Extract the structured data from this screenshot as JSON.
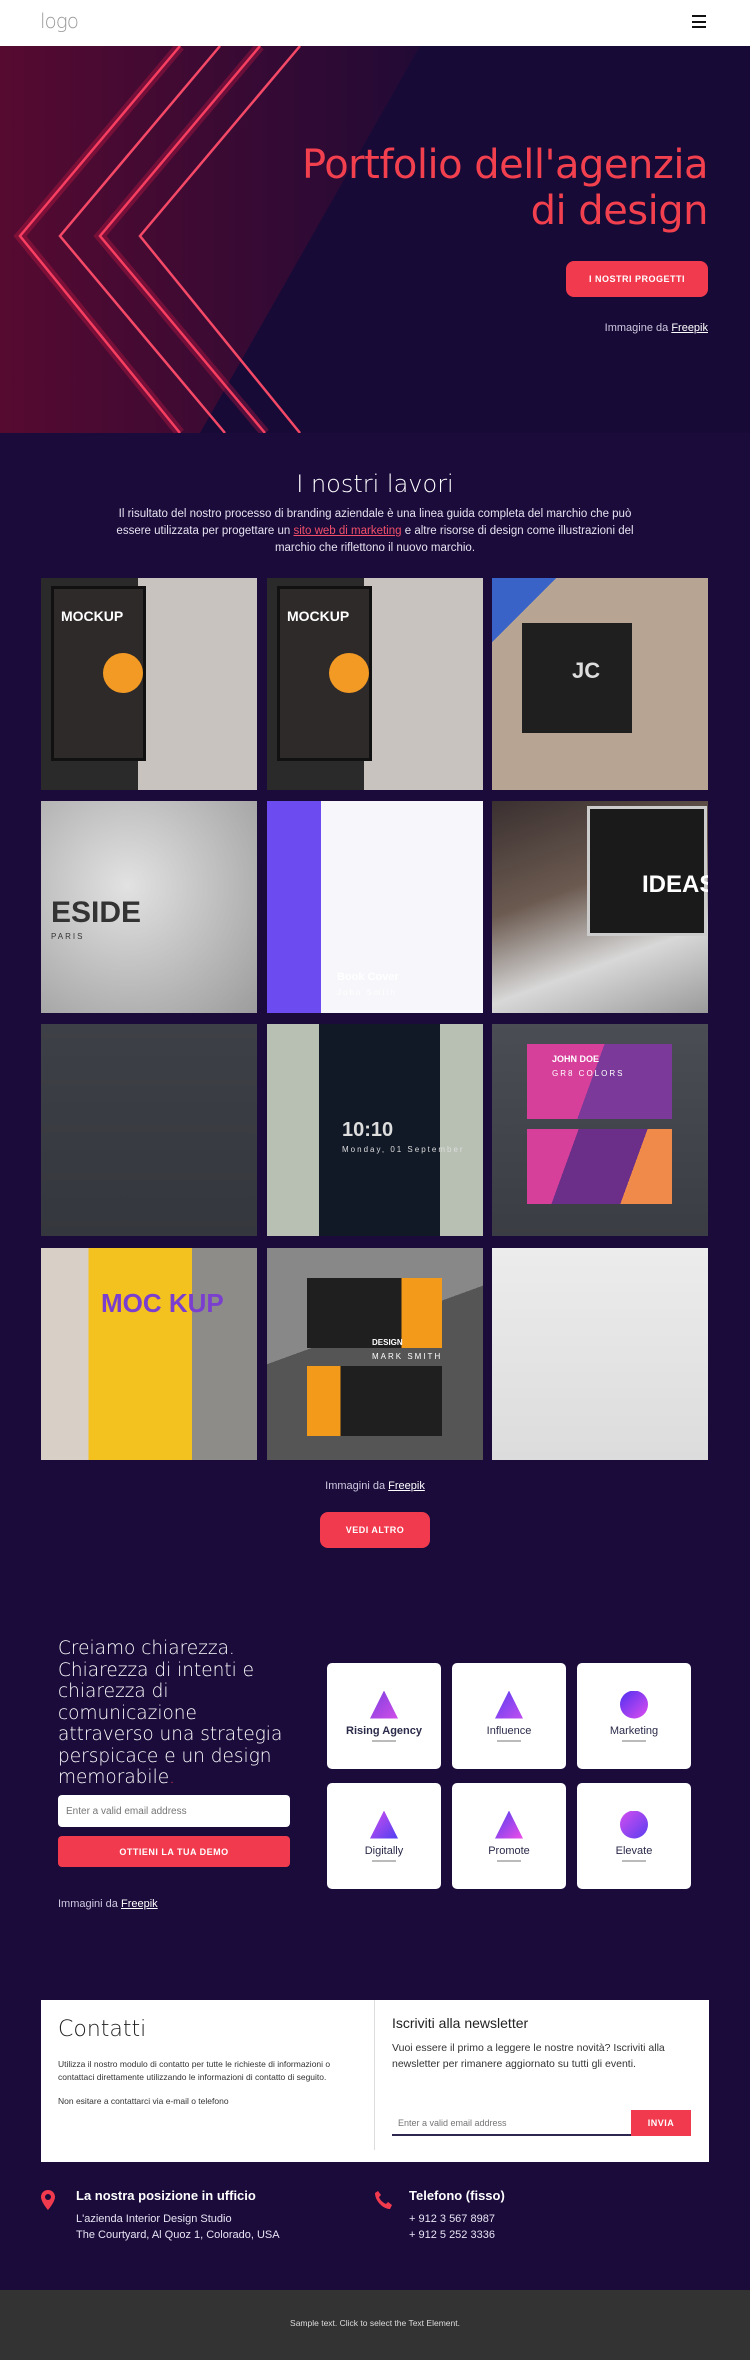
{
  "header": {
    "logo": "logo",
    "menu_icon": "hamburger-icon"
  },
  "hero": {
    "title_line1": "Portfolio dell'agenzia",
    "title_line2": "di design",
    "button": "I NOSTRI PROGETTI",
    "credit_prefix": "Immagine da",
    "credit_link": "Freepik"
  },
  "works": {
    "title": "I nostri lavori",
    "text_before": "Il risultato del nostro processo di branding aziendale è una linea guida completa del marchio che può essere utilizzata per progettare un ",
    "text_link": "sito web di marketing",
    "text_after": " e altre risorse di design come illustrazioni del marchio che riflettono il nuovo marchio.",
    "images": [
      {
        "label": "MOCKUP"
      },
      {
        "label": "MOCKUP"
      },
      {
        "label": "JC"
      },
      {
        "label": "ESIDE",
        "sub": "PARIS"
      },
      {
        "label": "Book Cover",
        "sub": "John Smith"
      },
      {
        "label": "IDEAS"
      },
      {
        "label": ""
      },
      {
        "label": "10:10",
        "sub": "Monday, 01 September"
      },
      {
        "label": "JOHN DOE",
        "sub": "GR8 COLORS"
      },
      {
        "label": "MOC KUP"
      },
      {
        "label": "DESIGN",
        "sub": "MARK SMITH"
      },
      {
        "label": ""
      }
    ],
    "credit_prefix": "Immagini da",
    "credit_link": "Freepik",
    "button": "VEDI ALTRO"
  },
  "claim": {
    "text": "Creiamo chiarezza. Chiarezza di intenti e chiarezza di comunicazione attraverso una strategia perspicace e un design memorabile",
    "dot": ".",
    "email_placeholder": "Enter a valid email address",
    "button": "OTTIENI LA TUA DEMO",
    "credit_prefix": "Immagini da",
    "credit_link": "Freepik",
    "logos": [
      {
        "name": "Rising Agency"
      },
      {
        "name": "Influence"
      },
      {
        "name": "Marketing"
      },
      {
        "name": "Digitally"
      },
      {
        "name": "Promote"
      },
      {
        "name": "Elevate"
      }
    ]
  },
  "contact": {
    "title": "Contatti",
    "text": "Utilizza il nostro modulo di contatto per tutte le richieste di informazioni o contattaci direttamente utilizzando le informazioni di contatto di seguito.",
    "text2": "Non esitare a contattarci via e-mail o telefono",
    "newsletter_title": "Iscriviti alla newsletter",
    "newsletter_text": "Vuoi essere il primo a leggere le nostre novità? Iscriviti alla newsletter per rimanere aggiornato su tutti gli eventi.",
    "email_placeholder": "Enter a valid email address",
    "button": "INVIA"
  },
  "info": {
    "office_title": "La nostra posizione in ufficio",
    "office_line1": "L'azienda Interior Design Studio",
    "office_line2": "The Courtyard, Al Quoz 1, Colorado,  USA",
    "phone_title": "Telefono (fisso)",
    "phone1": "+ 912 3 567 8987",
    "phone2": "+ 912 5 252 3336"
  },
  "footer": {
    "text": "Sample text. Click to select the Text Element."
  },
  "colors": {
    "background": "#1a0b3a",
    "accent": "#f23a4e",
    "footer": "#333333"
  }
}
